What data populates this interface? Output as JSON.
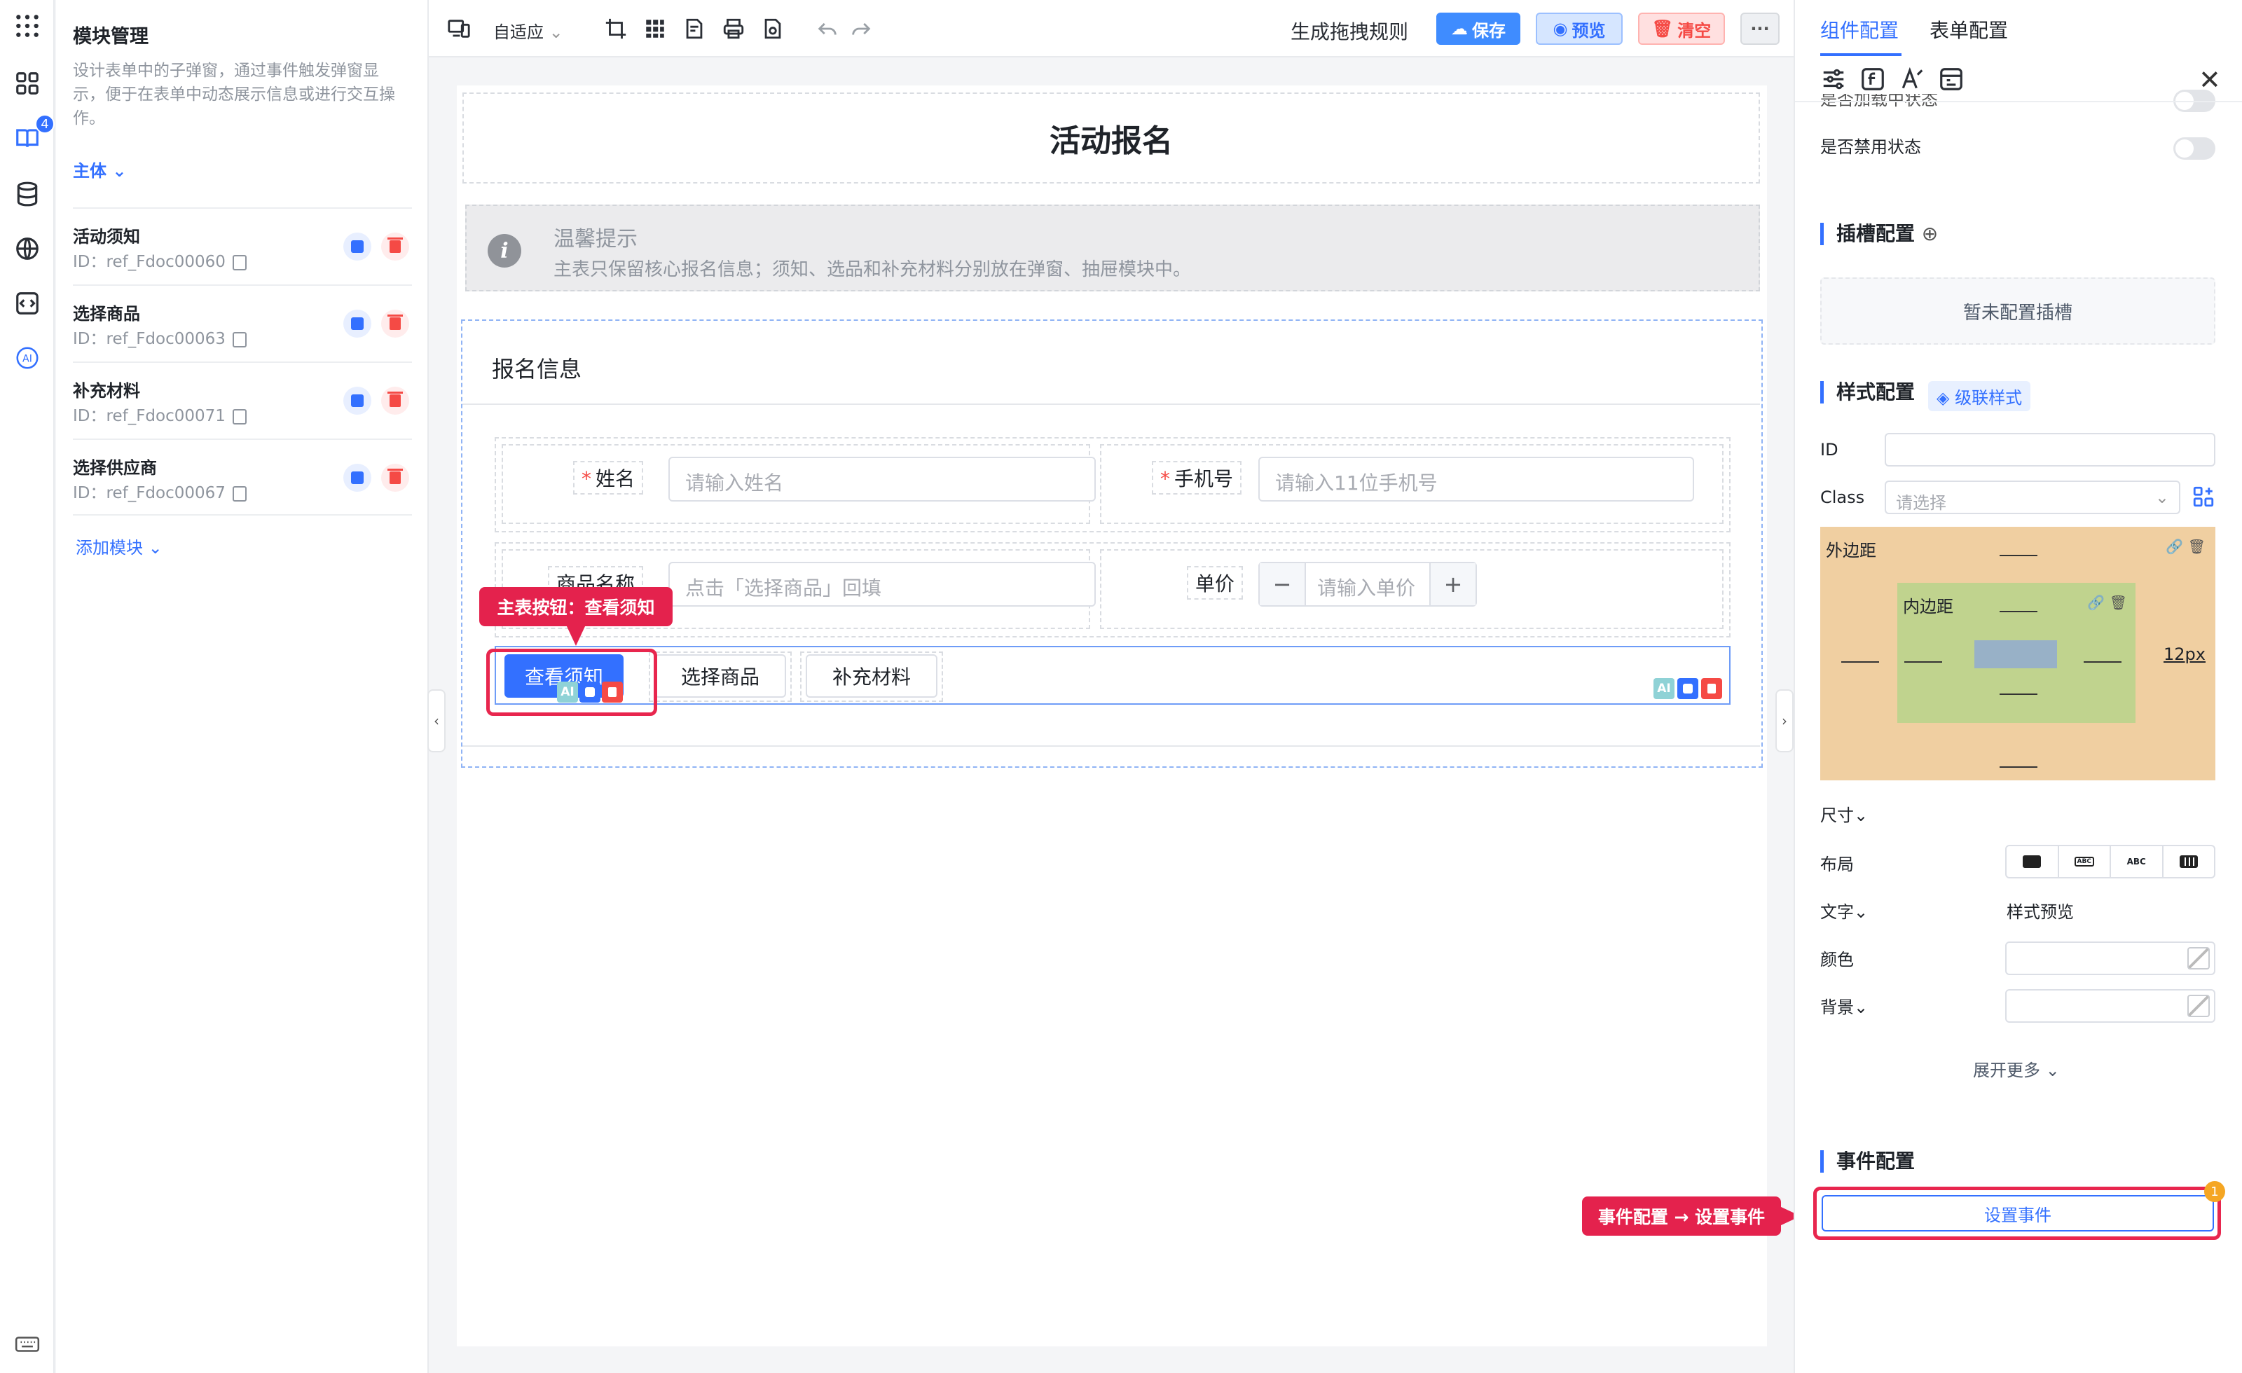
{
  "modules": {
    "title": "模块管理",
    "description": "设计表单中的子弹窗，通过事件触发弹窗显示，便于在表单中动态展示信息或进行交互操作。",
    "subject_label": "主体",
    "items": [
      {
        "name": "活动须知",
        "id": "ID：ref_Fdoc00060"
      },
      {
        "name": "选择商品",
        "id": "ID：ref_Fdoc00063"
      },
      {
        "name": "补充材料",
        "id": "ID：ref_Fdoc00071"
      },
      {
        "name": "选择供应商",
        "id": "ID：ref_Fdoc00067"
      }
    ],
    "add_label": "添加模块"
  },
  "rail": {
    "badge": "4",
    "icons": [
      "apps-grid-icon",
      "dashboard-icon",
      "book-icon",
      "database-icon",
      "globe-icon",
      "code-icon",
      "ai-icon",
      "keyboard-icon"
    ]
  },
  "toolbar": {
    "adapt_label": "自适应",
    "drag_rules": "生成拖拽规则",
    "save": "保存",
    "preview": "预览",
    "clear": "清空",
    "more": "···"
  },
  "form": {
    "title": "活动报名",
    "alert_title": "温馨提示",
    "alert_desc": "主表只保留核心报名信息；须知、选品和补充材料分别放在弹窗、抽屉模块中。",
    "section_title": "报名信息",
    "fields": {
      "name_label": "姓名",
      "name_placeholder": "请输入姓名",
      "phone_label": "手机号",
      "phone_placeholder": "请输入11位手机号",
      "product_label": "商品名称",
      "product_placeholder": "点击「选择商品」回填",
      "price_label": "单价",
      "price_placeholder": "请输入单价",
      "required_mark": "*"
    },
    "buttons": {
      "view": "查看须知",
      "select": "选择商品",
      "supplement": "补充材料"
    },
    "mini_ai": "AI"
  },
  "callouts": {
    "main_button": "主表按钮：查看须知",
    "event": "事件配置 → 设置事件"
  },
  "config": {
    "tabs": [
      "组件配置",
      "表单配置"
    ],
    "loading_state": "是否加载中状态",
    "disabled_state": "是否禁用状态",
    "slot_title": "插槽配置",
    "slot_empty": "暂未配置插槽",
    "style_title": "样式配置",
    "cascade": "级联样式",
    "id_label": "ID",
    "class_label": "Class",
    "class_placeholder": "请选择",
    "margin_label": "外边距",
    "padding_label": "内边距",
    "margin_right_value": "12px",
    "size_label": "尺寸",
    "layout_label": "布局",
    "layout_options": [
      "",
      "ABC",
      "ABC",
      ""
    ],
    "text_label": "文字",
    "style_preview": "样式预览",
    "color_label": "颜色",
    "bg_label": "背景",
    "expand_more": "展开更多",
    "event_title": "事件配置",
    "set_event": "设置事件",
    "event_badge": "1"
  },
  "colors": {
    "accent": "#3370ff",
    "danger": "#f54a45",
    "callout": "#e4224d",
    "margin_box": "#f0cfa1",
    "padding_box": "#c0d38e"
  }
}
